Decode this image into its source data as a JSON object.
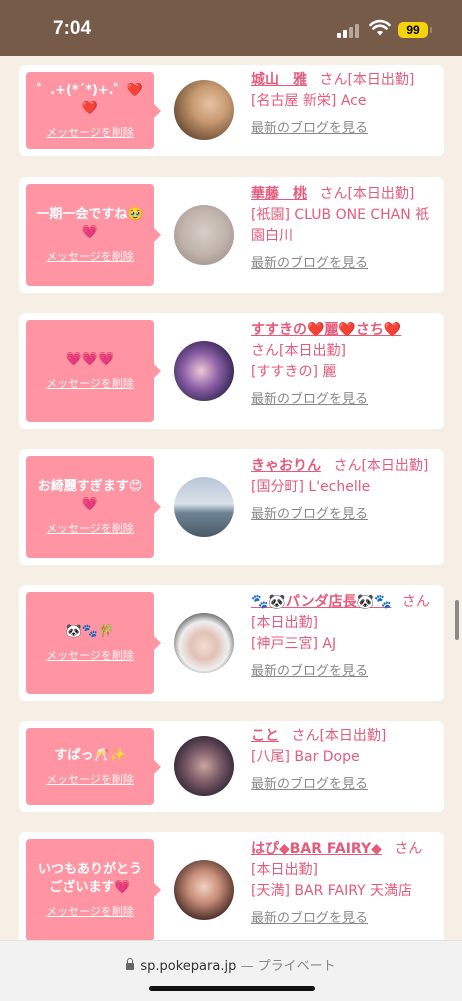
{
  "status": {
    "time": "7:04",
    "battery": "99"
  },
  "browser": {
    "domain": "sp.pokepara.jp",
    "separator": " — ",
    "mode": "プライベート"
  },
  "delete_label": "メッセージを削除",
  "blog_label": "最新のブログを見る",
  "items": [
    {
      "message": "゜.+(*´*)+.゜❤️❤️",
      "name": "城山　雅",
      "san": "さん",
      "status": "[本日出勤]",
      "area": "[名古屋 新栄]",
      "shop": "Ace"
    },
    {
      "message": "一期一会ですね🥹💗",
      "name": "華藤　桃",
      "san": "さん",
      "status": "[本日出勤]",
      "area": "[祇園]",
      "shop": "CLUB ONE CHAN 祇園白川"
    },
    {
      "message": "💗💗💗",
      "name": "すすきの❤️麗❤️さち❤️",
      "san": "さん",
      "status": "[本日出勤]",
      "area": "[すすきの]",
      "shop": "麗"
    },
    {
      "message": "お綺麗すぎます😍💗",
      "name": "きゃおりん",
      "san": "さん",
      "status": "[本日出勤]",
      "area": "[国分町]",
      "shop": "L'echelle"
    },
    {
      "message": "🐼🐾🎋",
      "name": "🐾🐼パンダ店長🐼🐾",
      "san": "さん",
      "status": "[本日出勤]",
      "area": "[神戸三宮]",
      "shop": "AJ"
    },
    {
      "message": "すぱっ🥂✨",
      "name": "こと",
      "san": "さん",
      "status": "[本日出勤]",
      "area": "[八尾]",
      "shop": "Bar Dope"
    },
    {
      "message": "いつもありがとうございます💗",
      "name": "はぴ◆BAR FAIRY◆",
      "san": "さん",
      "status": "[本日出勤]",
      "area": "[天満]",
      "shop": "BAR FAIRY 天満店"
    }
  ]
}
